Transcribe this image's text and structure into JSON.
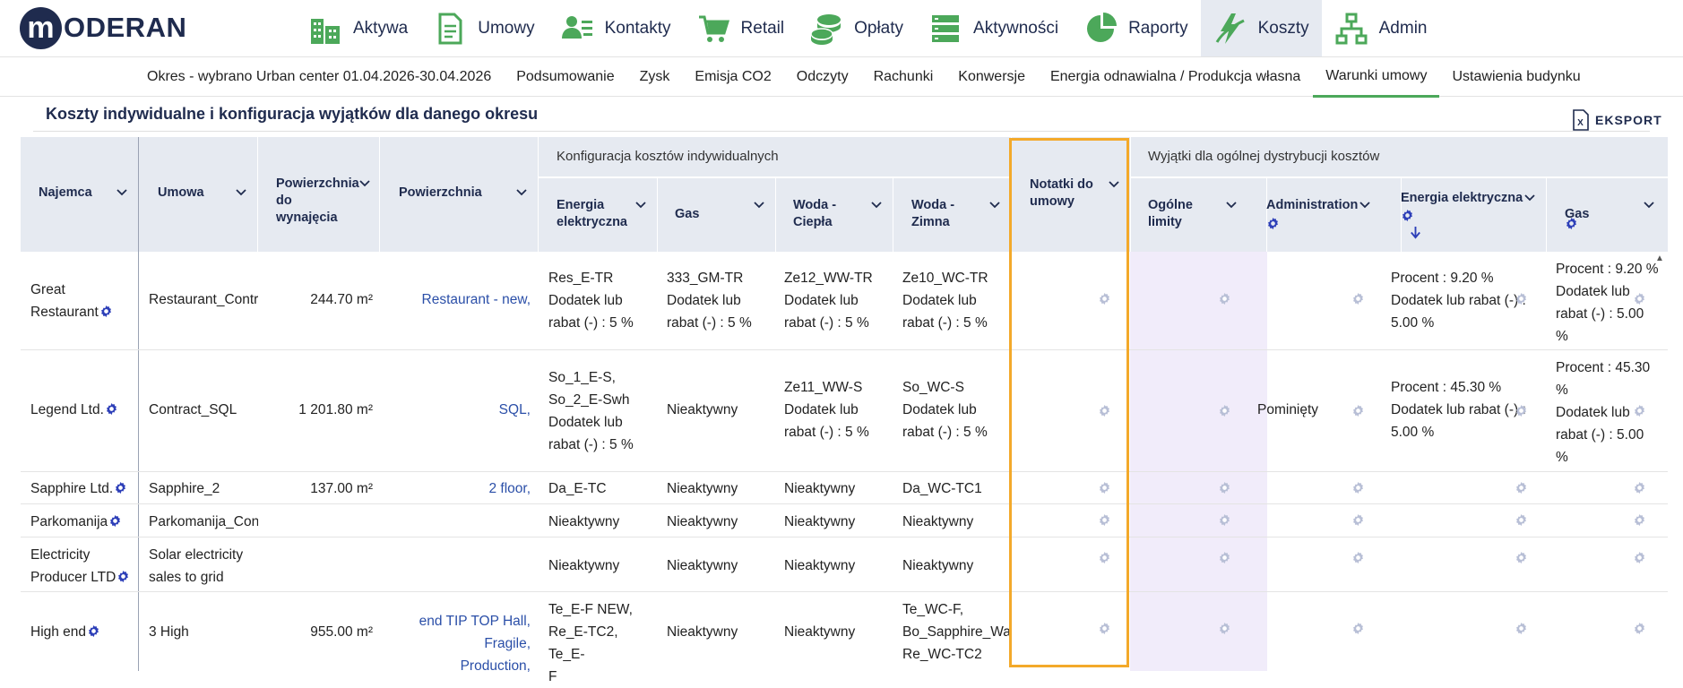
{
  "brand": {
    "logo_letter": "m",
    "logo_text": "ODERAN"
  },
  "nav": [
    {
      "label": "Aktywa",
      "icon": "buildings-icon"
    },
    {
      "label": "Umowy",
      "icon": "document-icon"
    },
    {
      "label": "Kontakty",
      "icon": "contacts-icon"
    },
    {
      "label": "Retail",
      "icon": "cart-icon"
    },
    {
      "label": "Opłaty",
      "icon": "coins-icon"
    },
    {
      "label": "Aktywności",
      "icon": "list-icon"
    },
    {
      "label": "Raporty",
      "icon": "pie-chart-icon"
    },
    {
      "label": "Koszty",
      "icon": "energy-icon",
      "active": true
    },
    {
      "label": "Admin",
      "icon": "hierarchy-icon"
    }
  ],
  "subnav": {
    "period": "Okres - wybrano Urban center 01.04.2026-30.04.2026",
    "items": [
      "Podsumowanie",
      "Zysk",
      "Emisja CO2",
      "Odczyty",
      "Rachunki",
      "Konwersje",
      "Energia odnawialna / Produkcja własna",
      "Warunki umowy",
      "Ustawienia budynku"
    ],
    "active": "Warunki umowy"
  },
  "section": {
    "title": "Koszty indywidualne i konfiguracja wyjątków dla danego okresu",
    "export_label": "EKSPORT"
  },
  "table": {
    "group_individual": "Konfiguracja kosztów indywidualnych",
    "group_exceptions": "Wyjątki dla ogólnej dystrybucji kosztów",
    "headers": {
      "tenant": "Najemca",
      "contract": "Umowa",
      "rentable_area": "Powierzchnia do wynajęcia",
      "area": "Powierzchnia",
      "energy": "Energia elektryczna",
      "gas": "Gas",
      "water_hot": "Woda - Ciepła",
      "water_cold": "Woda - Zimna",
      "notes": "Notatki do umowy",
      "limits": "Ogólne limity",
      "administration": "Administration",
      "exc_energy": "Energia elektryczna",
      "exc_gas": "Gas"
    },
    "rows": [
      {
        "tenant": "Great Restaurant",
        "contract": "Restaurant_Contr",
        "rentable_area": "244.70 m²",
        "area": "Restaurant - new,",
        "energy": [
          "Res_E-TR",
          "Dodatek lub",
          "rabat (-) : 5 %"
        ],
        "gas": [
          "333_GM-TR",
          "Dodatek lub",
          "rabat (-) : 5 %"
        ],
        "water_hot": [
          "Ze12_WW-TR",
          "Dodatek lub",
          "rabat (-) : 5 %"
        ],
        "water_cold": [
          "Ze10_WC-TR",
          "Dodatek lub",
          "rabat (-) : 5 %"
        ],
        "administration": "",
        "exc_energy": [
          "Procent : 9.20 %",
          "Dodatek lub rabat (-) :",
          "5.00 %"
        ],
        "exc_gas": [
          "Procent : 9.20 %",
          "Dodatek lub",
          "rabat (-) : 5.00",
          "%"
        ]
      },
      {
        "tenant": "Legend Ltd.",
        "contract": "Contract_SQL",
        "rentable_area": "1 201.80 m²",
        "area": "SQL,",
        "energy": [
          "So_1_E-S,",
          "So_2_E-Swh",
          "Dodatek lub",
          "rabat (-) : 5 %"
        ],
        "gas": [
          "Nieaktywny"
        ],
        "water_hot": [
          "Ze11_WW-S",
          "Dodatek lub",
          "rabat (-) : 5 %"
        ],
        "water_cold": [
          "So_WC-S",
          "Dodatek lub",
          "rabat (-) : 5 %"
        ],
        "administration": "Pominięty",
        "exc_energy": [
          "Procent : 45.30 %",
          "Dodatek lub rabat (-) :",
          "5.00 %"
        ],
        "exc_gas": [
          "Procent : 45.30",
          "%",
          "Dodatek lub",
          "rabat (-) : 5.00",
          "%"
        ]
      },
      {
        "tenant": "Sapphire Ltd.",
        "contract": "Sapphire_2",
        "rentable_area": "137.00 m²",
        "area": "2 floor,",
        "energy": [
          "Da_E-TC"
        ],
        "gas": [
          "Nieaktywny"
        ],
        "water_hot": [
          "Nieaktywny"
        ],
        "water_cold": [
          "Da_WC-TC1"
        ],
        "administration": "",
        "exc_energy": [],
        "exc_gas": []
      },
      {
        "tenant": "Parkomanija",
        "contract": "Parkomanija_Con",
        "rentable_area": "",
        "area": "",
        "energy": [
          "Nieaktywny"
        ],
        "gas": [
          "Nieaktywny"
        ],
        "water_hot": [
          "Nieaktywny"
        ],
        "water_cold": [
          "Nieaktywny"
        ],
        "administration": "",
        "exc_energy": [],
        "exc_gas": []
      },
      {
        "tenant": "Electricity Producer LTD",
        "contract": "Solar electricity sales to grid",
        "rentable_area": "",
        "area": "",
        "energy": [
          "Nieaktywny"
        ],
        "gas": [
          "Nieaktywny"
        ],
        "water_hot": [
          "Nieaktywny"
        ],
        "water_cold": [
          "Nieaktywny"
        ],
        "administration": "",
        "exc_energy": [],
        "exc_gas": []
      },
      {
        "tenant": "High end",
        "contract": "3 High",
        "rentable_area": "955.00 m²",
        "area": "end TIP TOP Hall, Fragile, Production,",
        "energy": [
          "Te_E-F NEW,",
          "Re_E-TC2, Te_E-",
          "F"
        ],
        "gas": [
          "Nieaktywny"
        ],
        "water_hot": [
          "Nieaktywny"
        ],
        "water_cold": [
          "Te_WC-F,",
          "Bo_Sapphire_Wat",
          "Re_WC-TC2"
        ],
        "administration": "",
        "exc_energy": [],
        "exc_gas": []
      }
    ]
  },
  "colors": {
    "accent_dark": "#1f2b4e",
    "accent_green": "#4ca85a",
    "link_blue": "#2b4fa8",
    "highlight_orange": "#f3a92a",
    "header_bg": "#e6eaf1",
    "lilac": "#f1ecfa",
    "gear_grey": "#b8bfd6",
    "gear_blue": "#2d3fb8"
  }
}
